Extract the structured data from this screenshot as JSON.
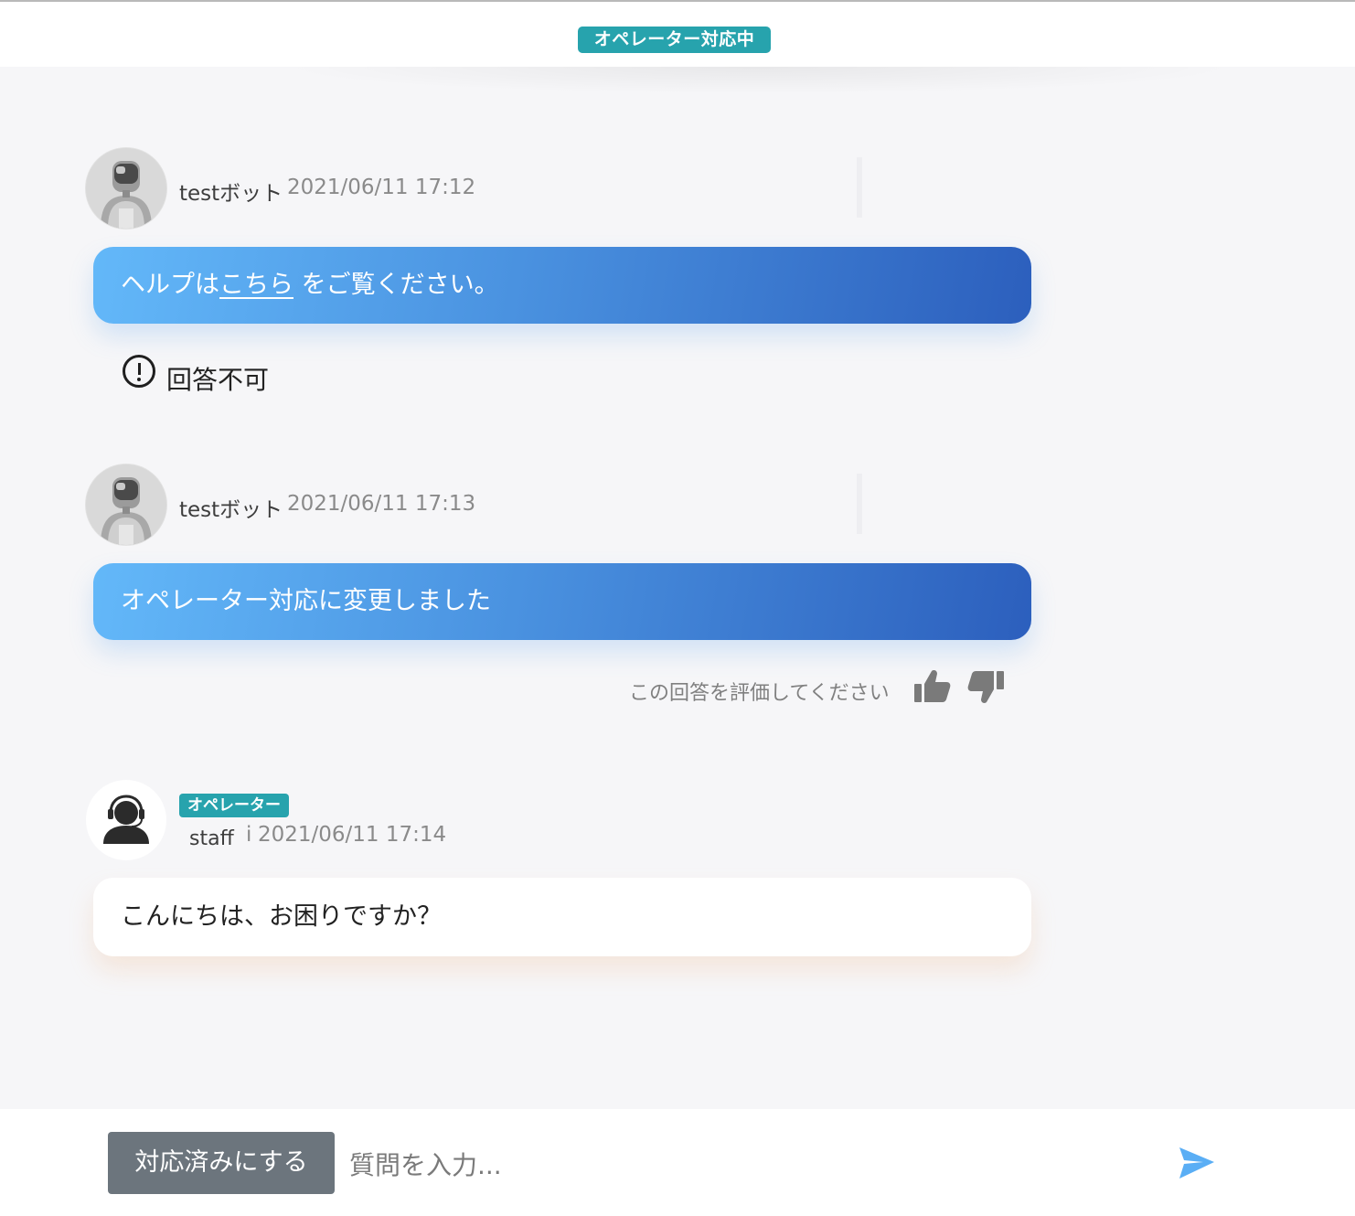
{
  "header": {
    "status_badge": "オペレーター対応中"
  },
  "messages": [
    {
      "sender": "testボット",
      "time": "2021/06/11 17:12",
      "text_before": "ヘルプは",
      "link_text": "こちら",
      "text_after": " をご覧ください。",
      "notice_icon": "exclamation-circle-icon",
      "notice": "回答不可"
    },
    {
      "sender": "testボット",
      "time": "2021/06/11 17:13",
      "text": "オペレーター対応に変更しました",
      "rating_prompt": "この回答を評価してください",
      "thumbs_up_icon": "thumbs-up-icon",
      "thumbs_down_icon": "thumbs-down-icon"
    },
    {
      "role_badge": "オペレーター",
      "sender": "staff",
      "time_prefix": "i",
      "time": "2021/06/11 17:14",
      "text": "こんにちは、お困りですか？"
    }
  ],
  "footer": {
    "resolve_button": "対応済みにする",
    "input_placeholder": "質問を入力...",
    "input_value": "",
    "send_icon": "send-arrow-icon"
  },
  "colors": {
    "badge": "#27a3ad",
    "bot_bubble_start": "#63b8f9",
    "bot_bubble_end": "#2c5fbd",
    "send_icon": "#5aaef5",
    "resolve_button": "#6c757d",
    "thumbs": "#7a7a7a"
  }
}
